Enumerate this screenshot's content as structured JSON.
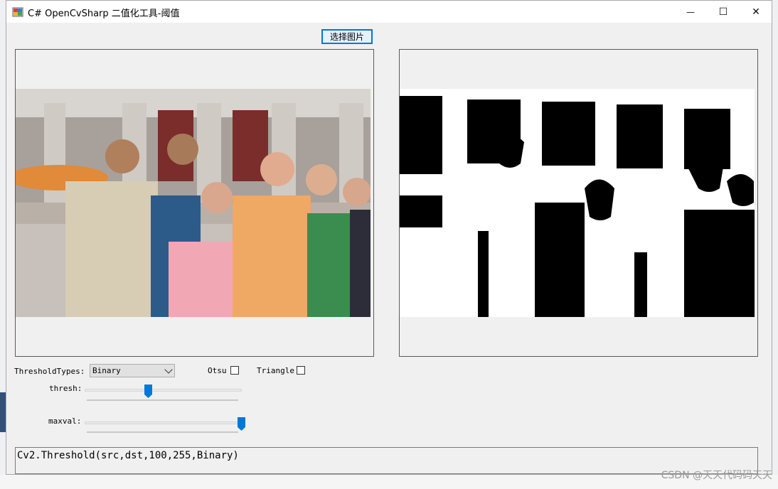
{
  "window": {
    "title": "C# OpenCvSharp 二值化工具-阈值",
    "controls": {
      "minimize": "—",
      "maximize": "☐",
      "close": "✕"
    }
  },
  "toolbar": {
    "select_image_label": "选择图片"
  },
  "controls": {
    "threshold_types_label": "ThresholdTypes:",
    "threshold_types_selected": "Binary",
    "otsu_label": "Otsu",
    "otsu_checked": false,
    "triangle_label": "Triangle",
    "triangle_checked": false,
    "thresh_label": "thresh:",
    "thresh_value": 100,
    "thresh_max": 255,
    "maxval_label": "maxval:",
    "maxval_value": 255,
    "maxval_max": 255
  },
  "output": {
    "code_text": "Cv2.Threshold(src,dst,100,255,Binary)"
  },
  "watermark": {
    "text": "CSDN @天天代码码天天"
  },
  "colors": {
    "accent": "#0078d7",
    "window_bg": "#f0f0f0"
  }
}
